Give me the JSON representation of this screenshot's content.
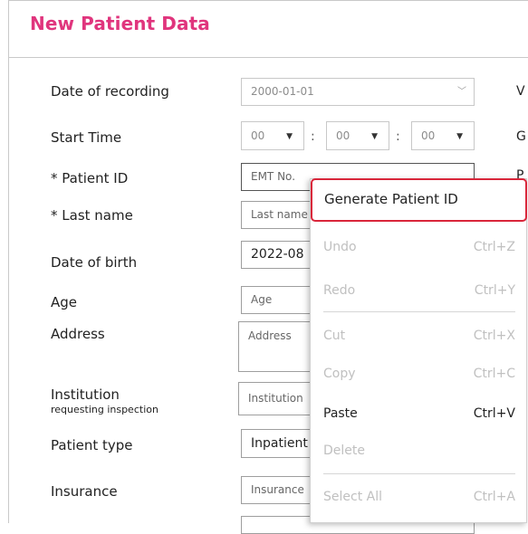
{
  "header": {
    "title": "New Patient Data"
  },
  "form": {
    "date_of_recording": {
      "label": "Date of recording",
      "value": "2000-01-01"
    },
    "start_time": {
      "label": "Start Time",
      "hour": "00",
      "minute": "00",
      "second": "00",
      "sep": ":"
    },
    "patient_id": {
      "label": "* Patient ID",
      "placeholder": "EMT No."
    },
    "last_name": {
      "label": "* Last name",
      "placeholder": "Last name"
    },
    "date_of_birth": {
      "label": "Date of birth",
      "value": "2022-08"
    },
    "age": {
      "label": "Age",
      "placeholder": "Age"
    },
    "address": {
      "label": "Address",
      "placeholder": "Address"
    },
    "institution": {
      "label": "Institution",
      "sublabel": "requesting inspection",
      "placeholder": "Institution"
    },
    "patient_type": {
      "label": "Patient type",
      "value": "Inpatient"
    },
    "insurance": {
      "label": "Insurance",
      "placeholder": "Insurance"
    }
  },
  "right_column_cut": {
    "v": "V",
    "g": "G",
    "p": "P"
  },
  "context_menu": {
    "generate": "Generate Patient ID",
    "undo": {
      "label": "Undo",
      "shortcut": "Ctrl+Z"
    },
    "redo": {
      "label": "Redo",
      "shortcut": "Ctrl+Y"
    },
    "cut": {
      "label": "Cut",
      "shortcut": "Ctrl+X"
    },
    "copy": {
      "label": "Copy",
      "shortcut": "Ctrl+C"
    },
    "paste": {
      "label": "Paste",
      "shortcut": "Ctrl+V"
    },
    "delete": {
      "label": "Delete"
    },
    "select_all": {
      "label": "Select All",
      "shortcut": "Ctrl+A"
    }
  },
  "colors": {
    "title": "#e0357d",
    "highlight_border": "#d9263a",
    "disabled_text": "#c0c0c0"
  }
}
